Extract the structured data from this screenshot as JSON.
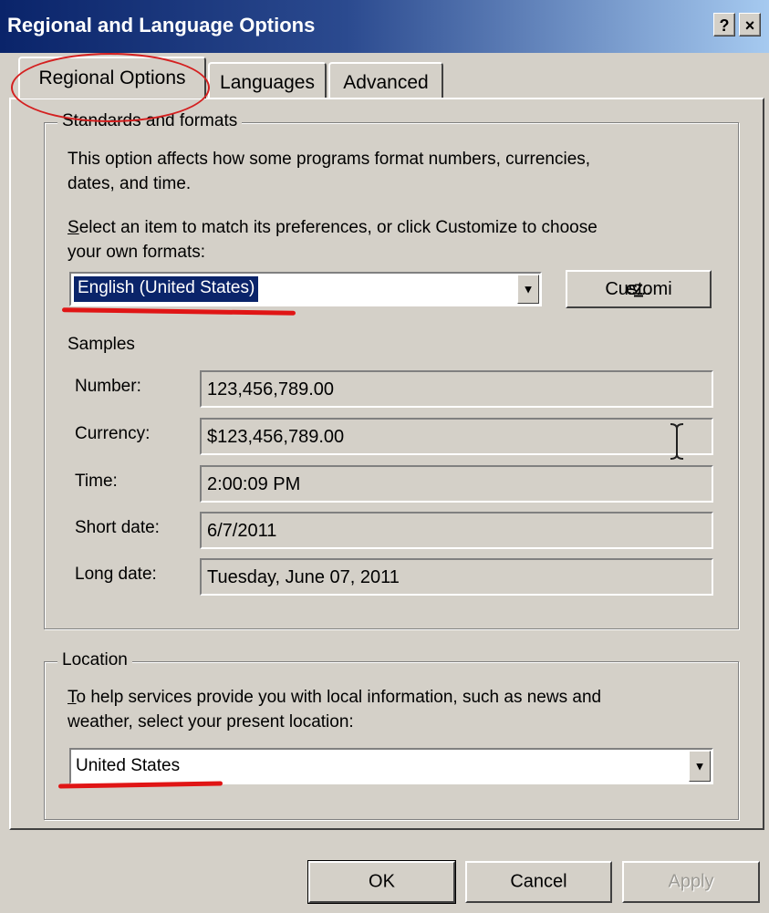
{
  "window": {
    "title": "Regional and Language Options",
    "help_button": "?",
    "close_button": "×"
  },
  "tabs": [
    {
      "label": "Regional Options",
      "active": true
    },
    {
      "label": "Languages",
      "active": false
    },
    {
      "label": "Advanced",
      "active": false
    }
  ],
  "standards": {
    "group_label": "Standards and formats",
    "description_line1": "This option affects how some programs format numbers, currencies,",
    "description_line2": "dates, and time.",
    "select_line1_key": "S",
    "select_line1_rest": "elect an item to match its preferences, or click Customize to choose",
    "select_line2": "your own formats:",
    "format_value": "English (United States)",
    "customize_pre": "Customi",
    "customize_key": "z",
    "customize_post": "e...",
    "samples_heading": "Samples",
    "samples": [
      {
        "label": "Number:",
        "value": "123,456,789.00"
      },
      {
        "label": "Currency:",
        "value": "$123,456,789.00"
      },
      {
        "label": "Time:",
        "value": "2:00:09 PM"
      },
      {
        "label": "Short date:",
        "value": "6/7/2011"
      },
      {
        "label": "Long date:",
        "value": "Tuesday, June 07, 2011"
      }
    ]
  },
  "location": {
    "group_label": "Location",
    "help_line1_key": "T",
    "help_line1_rest": "o help services provide you with local information, such as news and",
    "help_line2": "weather, select your present location:",
    "value": "United States"
  },
  "buttons": {
    "ok": "OK",
    "cancel": "Cancel",
    "apply": "Apply"
  },
  "colors": {
    "title_bar": "#0a246a",
    "face": "#d4d0c8",
    "selection": "#0a246a",
    "annotation": "#e01515"
  },
  "icons": {
    "dropdown": "triangle-down",
    "cursor": "i-beam"
  }
}
